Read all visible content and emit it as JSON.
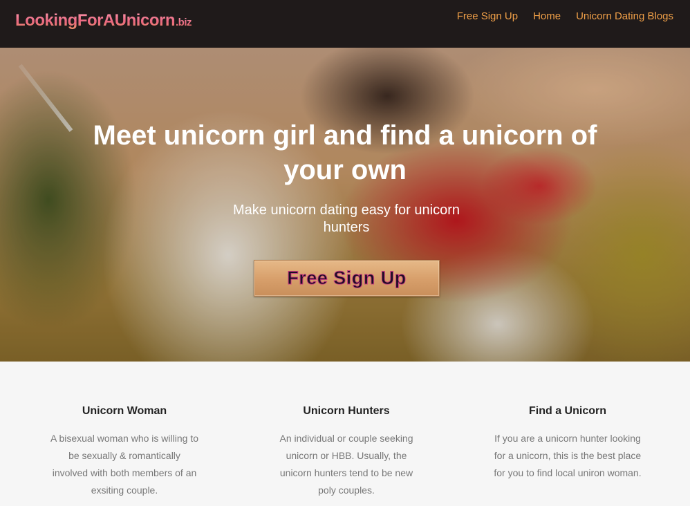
{
  "header": {
    "logo_main": "LookingForAUnicorn",
    "logo_tld": ".biz",
    "nav": [
      {
        "label": "Free Sign Up"
      },
      {
        "label": "Home"
      },
      {
        "label": "Unicorn Dating Blogs"
      }
    ]
  },
  "hero": {
    "title": "Meet unicorn girl and find a unicorn of your own",
    "subtitle": "Make unicorn dating easy for unicorn hunters",
    "cta_label": "Free Sign Up"
  },
  "features": [
    {
      "title": "Unicorn Woman",
      "text": "A bisexual woman who is willing to be sexually & romantically involved with both members of an exsiting couple."
    },
    {
      "title": "Unicorn Hunters",
      "text": "An individual or couple seeking unicorn or HBB. Usually, the unicorn hunters tend to be new poly couples."
    },
    {
      "title": "Find a Unicorn",
      "text": "If you are a unicorn hunter looking for a unicorn, this is the best place for you to find local uniron woman."
    }
  ],
  "colors": {
    "nav_bg": "#1f1a1a",
    "nav_link": "#f0a048",
    "logo": "#e8667e",
    "feature_bg": "#f6f6f6",
    "feature_text": "#777777"
  }
}
